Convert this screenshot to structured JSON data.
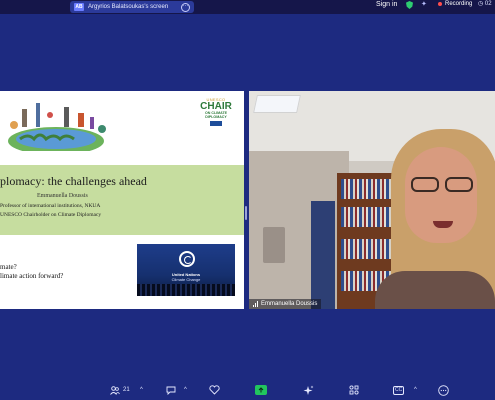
{
  "topbar": {
    "share_avatar": "AB",
    "share_title": "Argyrios Balatsoukas's screen",
    "sign_in": "Sign in",
    "recording": "Recording",
    "timer": "02",
    "colors": {
      "recording_dot": "#ff4d4d",
      "shield": "#2ecc71"
    }
  },
  "slide": {
    "logo_unesco": "UNESCO",
    "logo_chair": "CHAIR",
    "logo_sub_1": "ON CLIMATE",
    "logo_sub_2": "DIPLOMACY",
    "heading": "plomacy: the challenges ahead",
    "author": "Emmanuella Doussis",
    "role_1": "Professor of international institutions, NKUA",
    "role_2": "UNESCO Chairholder on Climate Diplomacy",
    "question_1": "mate?",
    "question_2": "limate action forward?",
    "unfccc_org": "United Nations",
    "unfccc_sub": "Climate Change"
  },
  "video": {
    "participant_name": "Emmanuella Doussis"
  },
  "toolbar": {
    "participants_count": "21",
    "icons": [
      "participants-icon",
      "chat-icon",
      "reactions-icon",
      "share-screen-icon",
      "ai-companion-icon",
      "apps-icon",
      "captions-icon",
      "more-icon"
    ],
    "cc_label": "CC",
    "share_color": "#22c55e"
  }
}
